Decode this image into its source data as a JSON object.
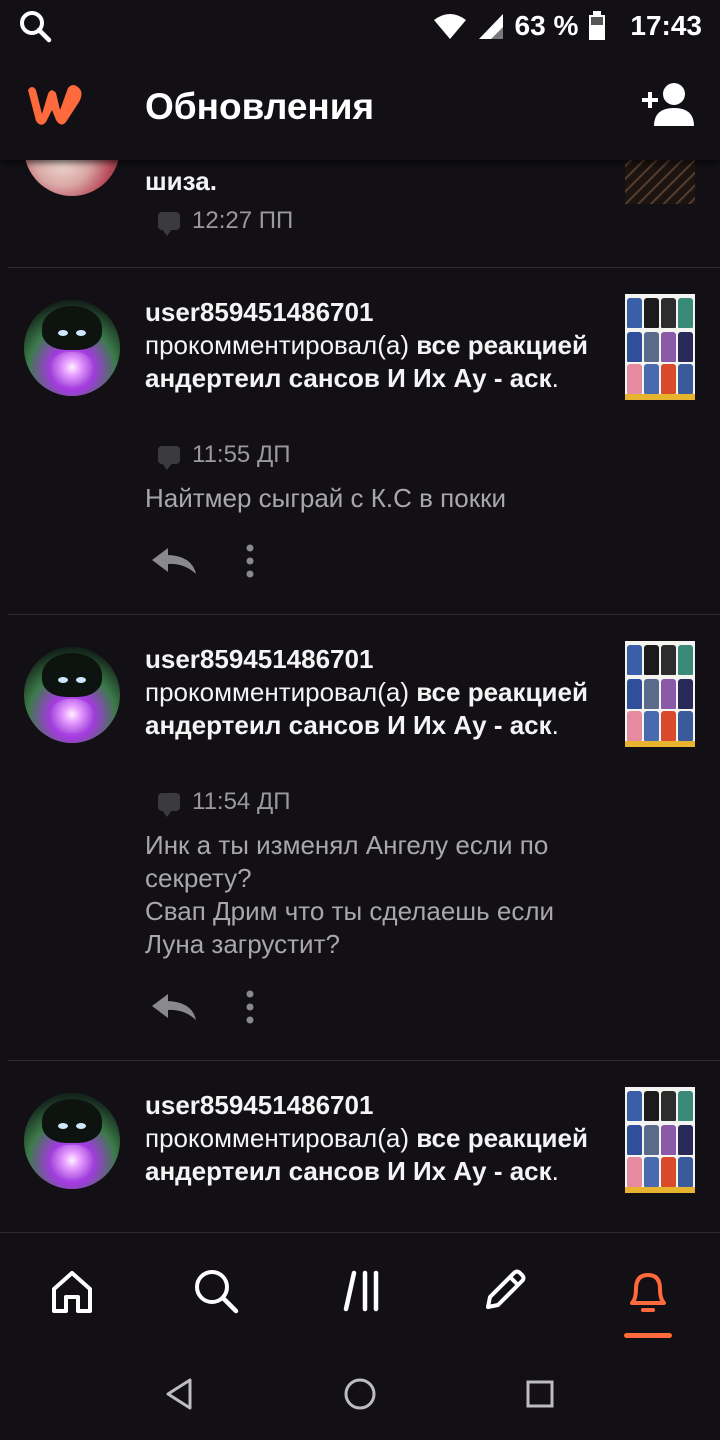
{
  "status_bar": {
    "battery": "63 %",
    "time": "17:43"
  },
  "app_bar": {
    "title": "Обновления"
  },
  "feed": {
    "partial_item": {
      "message_tail": "шиза.",
      "time": "12:27 ПП"
    },
    "items": [
      {
        "user": "user859451486701",
        "action": "прокомментировал(а)",
        "story": "все реакцией андертеил сансов И Их Ау - аск",
        "period": ".",
        "time": "11:55 ДП",
        "comment_lines": [
          "Найтмер сыграй с К.С в покки"
        ]
      },
      {
        "user": "user859451486701",
        "action": "прокомментировал(а)",
        "story": "все реакцией андертеил сансов И Их Ау - аск",
        "period": ".",
        "time": "11:54 ДП",
        "comment_lines": [
          "Инк а ты изменял Ангелу если по",
          "секрету?",
          "Свап Дрим что ты сделаешь если",
          "Луна загрустит?"
        ]
      },
      {
        "user": "user859451486701",
        "action": "прокомментировал(а)",
        "story": "все реакцией андертеил сансов И Их Ау - аск",
        "period": "."
      }
    ]
  },
  "bottom_nav": {
    "items": [
      "home",
      "search",
      "library",
      "write",
      "notifications"
    ],
    "active": "notifications",
    "accent_color": "#ff6a3c"
  },
  "colors": {
    "background": "#121015",
    "brand": "#ff6a3c"
  }
}
